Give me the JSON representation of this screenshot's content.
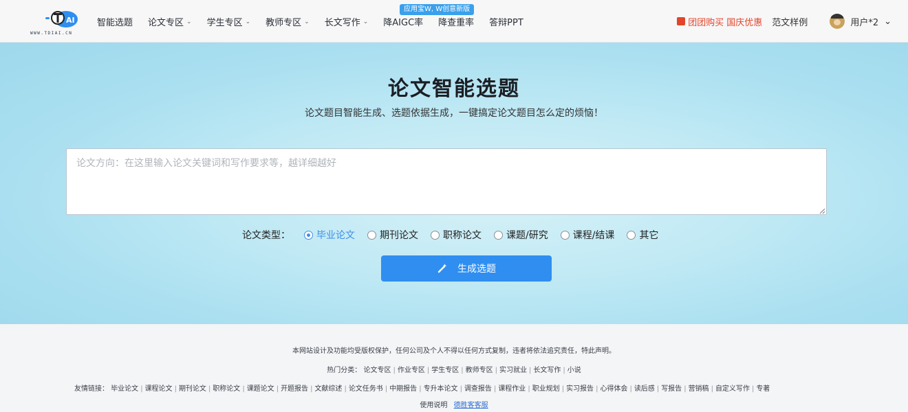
{
  "header": {
    "logo_text": "WWW.TDIAI.CN",
    "promo": "应用宝W, W创意新版",
    "nav": [
      {
        "label": "智能选题",
        "dropdown": false
      },
      {
        "label": "论文专区",
        "dropdown": true
      },
      {
        "label": "学生专区",
        "dropdown": true
      },
      {
        "label": "教师专区",
        "dropdown": true
      },
      {
        "label": "长文写作",
        "dropdown": true
      },
      {
        "label": "降AIGC率",
        "dropdown": false
      },
      {
        "label": "降查重率",
        "dropdown": false
      },
      {
        "label": "答辩PPT",
        "dropdown": false
      }
    ],
    "gift_label": "团团购买",
    "holiday_label": "国庆优惠",
    "samples_label": "范文样例",
    "user_label": "用户*2",
    "caret": "⌄",
    "colors": {
      "accent": "#2f8ef0",
      "promo": "#e2452a"
    }
  },
  "hero": {
    "title": "论文智能选题",
    "subtitle": "论文题目智能生成、选题依据生成，一键搞定论文题目怎么定的烦恼！",
    "input_placeholder": "论文方向：在这里输入论文关键词和写作要求等，越详细越好",
    "type_label": "论文类型：",
    "types": [
      {
        "label": "毕业论文",
        "selected": true
      },
      {
        "label": "期刊论文",
        "selected": false
      },
      {
        "label": "职称论文",
        "selected": false
      },
      {
        "label": "课题/研究",
        "selected": false
      },
      {
        "label": "课程/结课",
        "selected": false
      },
      {
        "label": "其它",
        "selected": false
      }
    ],
    "button_label": "生成选题",
    "button_icon": "magic-wand-icon"
  },
  "footer": {
    "notice": "本网站设计及功能均受版权保护，任何公司及个人不得以任何方式复制，违者将依法追究责任，特此声明。",
    "hot_label": "热门分类：",
    "hot": [
      "论文专区",
      "作业专区",
      "学生专区",
      "教师专区",
      "实习就业",
      "长文写作",
      "小说"
    ],
    "links_label": "友情链接：",
    "links": [
      "毕业论文",
      "课程论文",
      "期刊论文",
      "职称论文",
      "课题论文",
      "开题报告",
      "文献综述",
      "论文任务书",
      "中期报告",
      "专升本论文",
      "调查报告",
      "课程作业",
      "职业规划",
      "实习报告",
      "心得体会",
      "读后感",
      "写报告",
      "营销稿",
      "自定义写作",
      "专著"
    ],
    "bottom_label": "使用说明",
    "contact_label": "德胜客客服"
  }
}
